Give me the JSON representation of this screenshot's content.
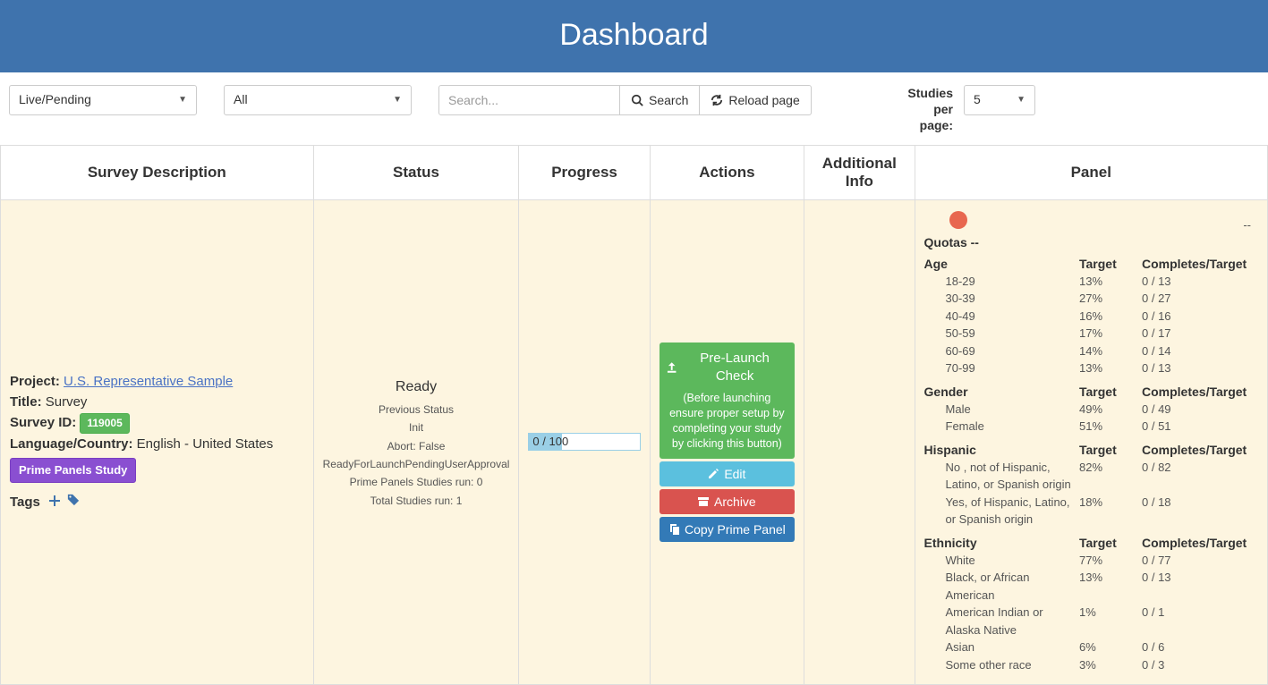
{
  "header": {
    "title": "Dashboard"
  },
  "filters": {
    "status_select": "Live/Pending",
    "type_select": "All",
    "search_placeholder": "Search...",
    "search_button": "Search",
    "reload_button": "Reload page",
    "perpage_label_l1": "Studies",
    "perpage_label_l2": "per",
    "perpage_label_l3": "page:",
    "perpage_value": "5"
  },
  "columns": {
    "desc": "Survey Description",
    "status": "Status",
    "progress": "Progress",
    "actions": "Actions",
    "addl": "Additional Info",
    "panel": "Panel"
  },
  "row": {
    "project_label": "Project: ",
    "project_link": "U.S. Representative Sample",
    "title_label": "Title: ",
    "title_value": "Survey",
    "surveyid_label": "Survey ID: ",
    "surveyid_value": "119005",
    "lang_label": "Language/Country: ",
    "lang_value": "English - United States",
    "study_badge": "Prime Panels Study",
    "tags_label": "Tags",
    "status_main": "Ready",
    "status_lines": [
      "Previous Status",
      "Init",
      "Abort: False",
      "ReadyForLaunchPendingUserApproval",
      "Prime Panels Studies run: 0",
      "Total Studies run: 1"
    ],
    "progress_text": "0 / 100",
    "actions": {
      "prelaunch_title": "Pre-Launch Check",
      "prelaunch_sub": "(Before launching ensure proper setup by completing your study by clicking this button)",
      "edit": "Edit",
      "archive": "Archive",
      "copy": "Copy Prime Panel"
    },
    "panel": {
      "dash": "--",
      "quotas_title": "Quotas --",
      "target_header": "Target",
      "completes_header": "Completes/Target",
      "groups": [
        {
          "name": "Age",
          "rows": [
            {
              "label": "18-29",
              "target": "13%",
              "ct": "0 / 13"
            },
            {
              "label": "30-39",
              "target": "27%",
              "ct": "0 / 27"
            },
            {
              "label": "40-49",
              "target": "16%",
              "ct": "0 / 16"
            },
            {
              "label": "50-59",
              "target": "17%",
              "ct": "0 / 17"
            },
            {
              "label": "60-69",
              "target": "14%",
              "ct": "0 / 14"
            },
            {
              "label": "70-99",
              "target": "13%",
              "ct": "0 / 13"
            }
          ]
        },
        {
          "name": "Gender",
          "rows": [
            {
              "label": "Male",
              "target": "49%",
              "ct": "0 / 49"
            },
            {
              "label": "Female",
              "target": "51%",
              "ct": "0 / 51"
            }
          ]
        },
        {
          "name": "Hispanic",
          "rows": [
            {
              "label": "No , not of Hispanic, Latino, or Spanish origin",
              "target": "82%",
              "ct": "0 / 82"
            },
            {
              "label": "Yes, of Hispanic, Latino, or Spanish origin",
              "target": "18%",
              "ct": "0 / 18"
            }
          ]
        },
        {
          "name": "Ethnicity",
          "rows": [
            {
              "label": "White",
              "target": "77%",
              "ct": "0 / 77"
            },
            {
              "label": "Black, or African American",
              "target": "13%",
              "ct": "0 / 13"
            },
            {
              "label": "American Indian or Alaska Native",
              "target": "1%",
              "ct": "0 / 1"
            },
            {
              "label": "Asian",
              "target": "6%",
              "ct": "0 / 6"
            },
            {
              "label": "Some other race",
              "target": "3%",
              "ct": "0 / 3"
            }
          ]
        }
      ]
    }
  }
}
